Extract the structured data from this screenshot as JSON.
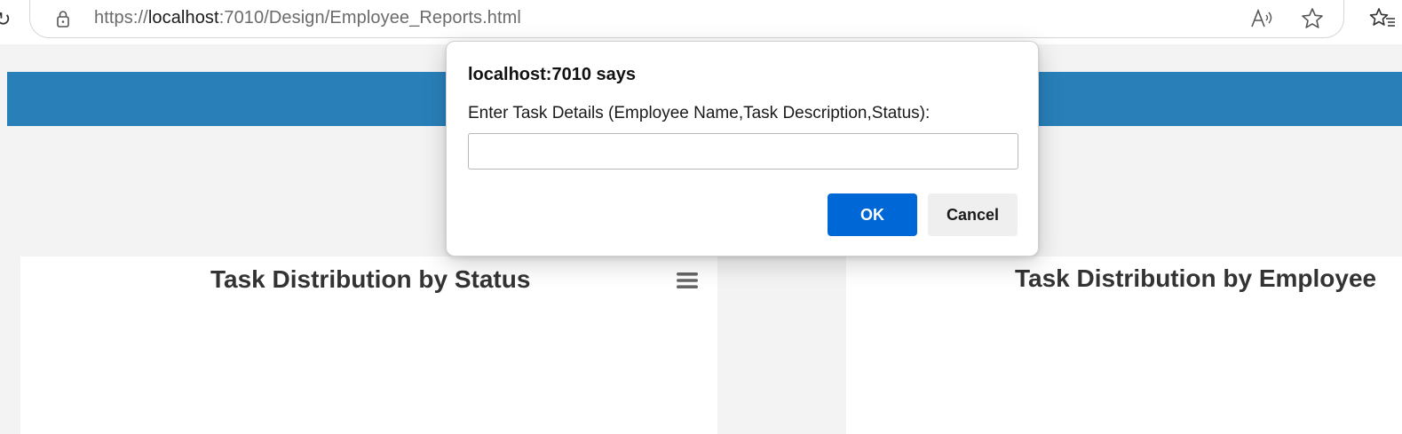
{
  "browser": {
    "url_scheme": "https://",
    "url_host": "localhost",
    "url_rest": ":7010/Design/Employee_Reports.html",
    "icons": [
      "lock-icon",
      "read-aloud-icon",
      "favorite-star-icon",
      "favorites-icon"
    ]
  },
  "page": {
    "header_color": "#2980b9",
    "charts": [
      {
        "title": "Task Distribution by Status"
      },
      {
        "title": "Task Distribution by Employee"
      }
    ]
  },
  "dialog": {
    "title": "localhost:7010 says",
    "message": "Enter Task Details (Employee Name,Task Description,Status):",
    "input_value": "",
    "ok_label": "OK",
    "cancel_label": "Cancel",
    "ok_color": "#0067d6"
  }
}
